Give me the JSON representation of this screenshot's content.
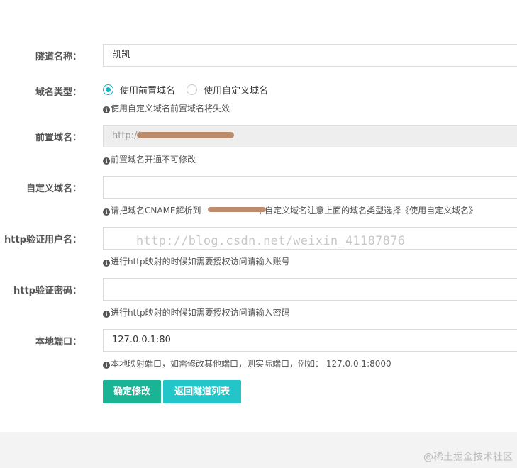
{
  "form": {
    "tunnel_name": {
      "label": "隧道名称：",
      "value": "凯凯"
    },
    "domain_type": {
      "label": "域名类型：",
      "options": [
        {
          "label": "使用前置域名",
          "selected": true
        },
        {
          "label": "使用自定义域名",
          "selected": false
        }
      ],
      "hint": "使用自定义域名前置域名将失效"
    },
    "prefix_domain": {
      "label": "前置域名：",
      "value": "http://",
      "hint": "前置域名开通不可修改"
    },
    "custom_domain": {
      "label": "自定义域名：",
      "value": "",
      "hint_part1": "请把域名CNAME解析到",
      "hint_part2": ", 自定义域名注意上面的域名类型选择《使用自定义域名》"
    },
    "http_user": {
      "label": "http验证用户名：",
      "value": "",
      "hint": "进行http映射的时候如需要授权访问请输入账号"
    },
    "http_password": {
      "label": "http验证密码：",
      "value": "",
      "hint": "进行http映射的时候如需要授权访问请输入密码"
    },
    "local_port": {
      "label": "本地端口：",
      "value": "127.0.0.1:80",
      "hint": "本地映射端口，如需修改其他端口，则实际端口，例如： 127.0.0.1:8000"
    }
  },
  "buttons": {
    "confirm": "确定修改",
    "back": "返回隧道列表"
  },
  "watermarks": {
    "center": "http://blog.csdn.net/weixin_41187876",
    "corner": "@稀土掘金技术社区"
  },
  "colors": {
    "primary": "#1ab394",
    "secondary": "#23c6c8",
    "radio_accent": "#18b4c5"
  },
  "icons": {
    "info": "info-circle-icon"
  }
}
